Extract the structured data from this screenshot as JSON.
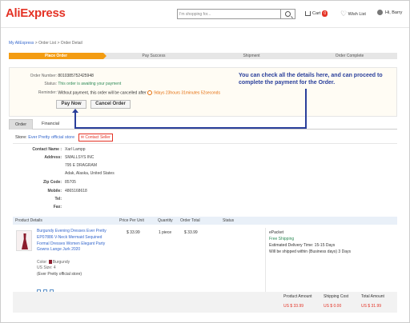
{
  "header": {
    "logo": "AliExpress",
    "search_placeholder": "I'm shopping for...",
    "cart_label": "Cart",
    "cart_count": "0",
    "wishlist_label": "Wish List",
    "greeting": "Hi, Barry"
  },
  "breadcrumb": {
    "home": "My AliExpress",
    "sep1": " > ",
    "orders": "Order List",
    "sep2": " > ",
    "current": "Order Detail"
  },
  "steps": [
    "Place Order",
    "Pay Success",
    "Shipment",
    "Order Complete"
  ],
  "order": {
    "number_label": "Order Number:",
    "number": "8010385752425948",
    "status_label": "Status:",
    "status": "This order is awaiting your payment",
    "reminder_label": "Reminder:",
    "reminder_text": "Without payment, this order will be cancelled after",
    "countdown": "9days 23hours 31minutes 52seconds",
    "pay_now": "Pay Now",
    "cancel_order": "Cancel Order"
  },
  "annotation": "You can check all the details here, and can proceed to complete the payment for the Order.",
  "tabs": [
    "Order",
    "Financial"
  ],
  "store": {
    "label": "Store:",
    "name": "Ever Pretty official store",
    "contact": "Contact Seller"
  },
  "address": {
    "contact_name_label": "Contact Name :",
    "contact_name": "Xarl Lampp",
    "address_label": "Address:",
    "address_lines": [
      "SMALLSYS INC",
      "795 E DRAGRAM",
      "Adak, Alaska, United States"
    ],
    "zip_label": "Zip Code:",
    "zip": "85705",
    "mobile_label": "Mobile:",
    "mobile": "4865168618",
    "tel_label": "Tel:",
    "tel": "",
    "fax_label": "Fax:",
    "fax": ""
  },
  "table_headers": {
    "details": "Product Details",
    "price": "Price Per Unit",
    "qty": "Quantity",
    "total": "Order Total",
    "status": "Status"
  },
  "product": {
    "title": "Burgundy Evening Dresses Ever Pretty EP07886 V-Neck Mermaid Sequined Formal Dresses Women Elegant Party Gowns Lange Jurk 2020",
    "color_label": "Color:",
    "color": "Burgundy",
    "size_label": "US Size:",
    "size": "4",
    "store_note": "(Ever Pretty official store)",
    "price": "$ 33.99",
    "quantity": "1 piece",
    "total": "$ 33.99",
    "shipping_method": "ePacket",
    "free_shipping": "Free Shipping",
    "delivery": "Estimated Delivery Time: 15-15 Days",
    "ship_within": "Will be shipped within (Business days) 3 Days"
  },
  "totals": {
    "product_amount_label": "Product Amount",
    "product_amount": "US $ 33.99",
    "shipping_cost_label": "Shipping Cost",
    "shipping_cost": "US $ 0.00",
    "total_amount_label": "Total Amount",
    "total_amount": "US $ 31.99"
  },
  "colors": {
    "brand": "#e43225",
    "step_active": "#f39c12",
    "annotation": "#2a3f9b",
    "link": "#3366cc"
  }
}
